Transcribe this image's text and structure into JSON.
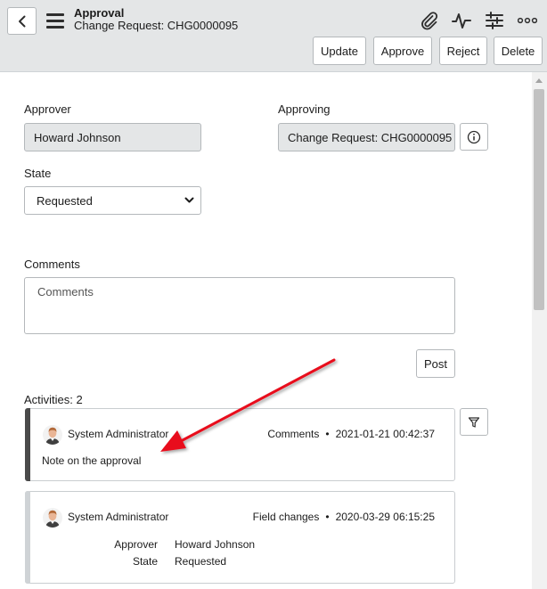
{
  "header": {
    "title": "Approval",
    "subtitle": "Change Request: CHG0000095",
    "buttons": {
      "update": "Update",
      "approve": "Approve",
      "reject": "Reject",
      "delete": "Delete"
    },
    "icons": [
      "back-icon",
      "menu-icon",
      "paperclip-icon",
      "activity-icon",
      "settings-sliders-icon",
      "more-icon"
    ]
  },
  "form": {
    "approver": {
      "label": "Approver",
      "value": "Howard Johnson"
    },
    "approving": {
      "label": "Approving",
      "value": "Change Request: CHG0000095"
    },
    "state": {
      "label": "State",
      "value": "Requested"
    },
    "comments": {
      "label": "Comments",
      "placeholder": "Comments"
    },
    "post_label": "Post"
  },
  "activities": {
    "heading": "Activities: 2",
    "items": [
      {
        "user": "System Administrator",
        "type": "Comments",
        "timestamp": "2021-01-21 00:42:37",
        "note": "Note on the approval"
      },
      {
        "user": "System Administrator",
        "type": "Field changes",
        "timestamp": "2020-03-29 06:15:25",
        "fields": [
          {
            "label": "Approver",
            "value": "Howard Johnson"
          },
          {
            "label": "State",
            "value": "Requested"
          }
        ]
      }
    ]
  },
  "colors": {
    "header_bg": "#e4e6e7",
    "active_bar": "#4a4a4a",
    "inactive_bar": "#cfd3d6",
    "annotation_arrow": "#e8101e"
  }
}
